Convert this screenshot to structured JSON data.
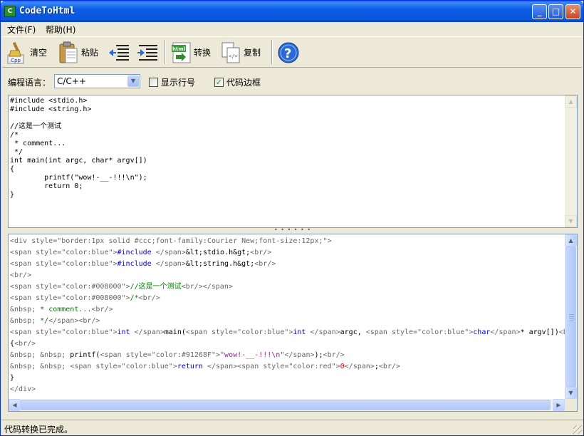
{
  "window": {
    "title": "CodeToHtml",
    "app_icon_text": "C",
    "controls": {
      "minimize": "_",
      "maximize": "□",
      "close": "✕"
    }
  },
  "menu": [
    {
      "label": "文件(F)"
    },
    {
      "label": "帮助(H)"
    }
  ],
  "toolbar": {
    "clear_label": "清空",
    "paste_label": "粘贴",
    "convert_label": "转换",
    "copy_label": "复制",
    "clear_icon_text": ".Cpp",
    "convert_icon_text": "html"
  },
  "options": {
    "language_label": "编程语言：",
    "language_value": "C/C++",
    "show_line_numbers_label": "显示行号",
    "show_line_numbers_checked": false,
    "code_border_label": "代码边框",
    "code_border_checked": true
  },
  "source_code": [
    "#include <stdio.h>",
    "#include <string.h>",
    "",
    "//这是一个测试",
    "/*",
    " * comment...",
    " */",
    "int main(int argc, char* argv[])",
    "{",
    "        printf(\"wow!-__-!!!\\n\");",
    "        return 0;",
    "}"
  ],
  "output_lines": [
    [
      {
        "t": "<div style=\"border:1px solid #ccc;font-family:Courier New;font-size:12px;\">",
        "c": "gray"
      }
    ],
    [
      {
        "t": "<span style=\"color:blue\">",
        "c": "gray"
      },
      {
        "t": "#include ",
        "c": "blue"
      },
      {
        "t": "</span>",
        "c": "gray"
      },
      {
        "t": "&lt;stdio.h&gt;",
        "c": "black"
      },
      {
        "t": "<br/>",
        "c": "gray"
      }
    ],
    [
      {
        "t": "<span style=\"color:blue\">",
        "c": "gray"
      },
      {
        "t": "#include ",
        "c": "blue"
      },
      {
        "t": "</span>",
        "c": "gray"
      },
      {
        "t": "&lt;string.h&gt;",
        "c": "black"
      },
      {
        "t": "<br/>",
        "c": "gray"
      }
    ],
    [
      {
        "t": "<br/>",
        "c": "gray"
      }
    ],
    [
      {
        "t": "<span style=\"color:#008000\">",
        "c": "gray"
      },
      {
        "t": "//这是一个测试",
        "c": "green"
      },
      {
        "t": "<br/></span>",
        "c": "gray"
      }
    ],
    [
      {
        "t": "<span style=\"color:#008000\">",
        "c": "gray"
      },
      {
        "t": "/*",
        "c": "green"
      },
      {
        "t": "<br/>",
        "c": "gray"
      }
    ],
    [
      {
        "t": "&nbsp; ",
        "c": "gray"
      },
      {
        "t": "* comment...",
        "c": "green"
      },
      {
        "t": "<br/>",
        "c": "gray"
      }
    ],
    [
      {
        "t": "&nbsp; ",
        "c": "gray"
      },
      {
        "t": "*/",
        "c": "green"
      },
      {
        "t": "</span><br/>",
        "c": "gray"
      }
    ],
    [
      {
        "t": "<span style=\"color:blue\">",
        "c": "gray"
      },
      {
        "t": "int ",
        "c": "blue"
      },
      {
        "t": "</span>",
        "c": "gray"
      },
      {
        "t": "main(",
        "c": "black"
      },
      {
        "t": "<span style=\"color:blue\">",
        "c": "gray"
      },
      {
        "t": "int ",
        "c": "blue"
      },
      {
        "t": "</span>",
        "c": "gray"
      },
      {
        "t": "argc, ",
        "c": "black"
      },
      {
        "t": "<span style=\"color:blue\">",
        "c": "gray"
      },
      {
        "t": "char",
        "c": "blue"
      },
      {
        "t": "</span>",
        "c": "gray"
      },
      {
        "t": "* argv[])",
        "c": "black"
      },
      {
        "t": "<b",
        "c": "gray"
      }
    ],
    [
      {
        "t": "{",
        "c": "black"
      },
      {
        "t": "<br/>",
        "c": "gray"
      }
    ],
    [
      {
        "t": "&nbsp; &nbsp; ",
        "c": "gray"
      },
      {
        "t": "printf(",
        "c": "black"
      },
      {
        "t": "<span style=\"color:#91268F\">",
        "c": "gray"
      },
      {
        "t": "\"wow!-__-!!!\\n\"",
        "c": "purple"
      },
      {
        "t": "</span>",
        "c": "gray"
      },
      {
        "t": ");",
        "c": "black"
      },
      {
        "t": "<br/>",
        "c": "gray"
      }
    ],
    [
      {
        "t": "&nbsp; &nbsp; ",
        "c": "gray"
      },
      {
        "t": "<span style=\"color:blue\">",
        "c": "gray"
      },
      {
        "t": "return ",
        "c": "blue"
      },
      {
        "t": "</span>",
        "c": "gray"
      },
      {
        "t": "<span style=\"color:red\">",
        "c": "gray"
      },
      {
        "t": "0",
        "c": "red"
      },
      {
        "t": "</span>",
        "c": "gray"
      },
      {
        "t": ";",
        "c": "black"
      },
      {
        "t": "<br/>",
        "c": "gray"
      }
    ],
    [
      {
        "t": "}",
        "c": "black"
      }
    ],
    [
      {
        "t": "</div>",
        "c": "gray"
      }
    ]
  ],
  "status": {
    "text": "代码转换已完成。"
  },
  "colors": {
    "titlebar": "#0a56dc",
    "keyword": "#0000ff",
    "comment": "#008000",
    "string": "#91268f",
    "number": "#ff0000"
  }
}
